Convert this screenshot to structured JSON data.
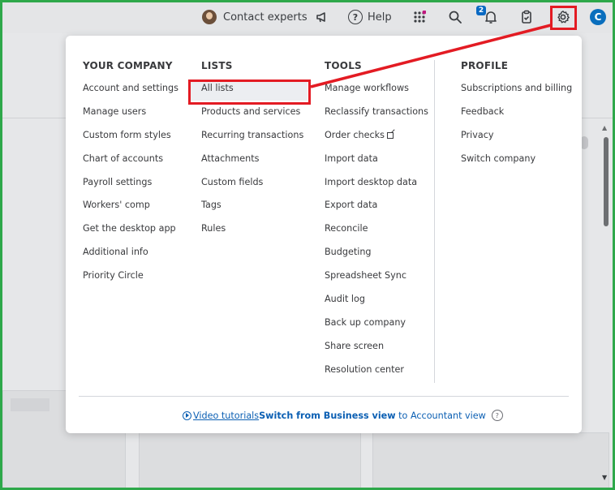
{
  "topbar": {
    "contact_experts": "Contact experts",
    "help_label": "Help",
    "notification_count": "2",
    "user_initial": "C"
  },
  "menu": {
    "columns": [
      {
        "heading": "YOUR COMPANY",
        "items": [
          "Account and settings",
          "Manage users",
          "Custom form styles",
          "Chart of accounts",
          "Payroll settings",
          "Workers' comp",
          "Get the desktop app",
          "Additional info",
          "Priority Circle"
        ]
      },
      {
        "heading": "LISTS",
        "items": [
          "All lists",
          "Products and services",
          "Recurring transactions",
          "Attachments",
          "Custom fields",
          "Tags",
          "Rules"
        ]
      },
      {
        "heading": "TOOLS",
        "items": [
          "Manage workflows",
          "Reclassify transactions",
          "Order checks",
          "Import data",
          "Import desktop data",
          "Export data",
          "Reconcile",
          "Budgeting",
          "Spreadsheet Sync",
          "Audit log",
          "Back up company",
          "Share screen",
          "Resolution center"
        ]
      },
      {
        "heading": "PROFILE",
        "items": [
          "Subscriptions and billing",
          "Feedback",
          "Privacy",
          "Switch company"
        ]
      }
    ],
    "footer": {
      "video_tutorials": "Video tutorials",
      "switch_prefix": "Switch from Business view",
      "switch_mid": " to ",
      "switch_suffix": "Accountant view"
    }
  },
  "colors": {
    "frame_border": "#2ea84a",
    "highlight": "#e31b23",
    "link": "#0b5fb3"
  }
}
